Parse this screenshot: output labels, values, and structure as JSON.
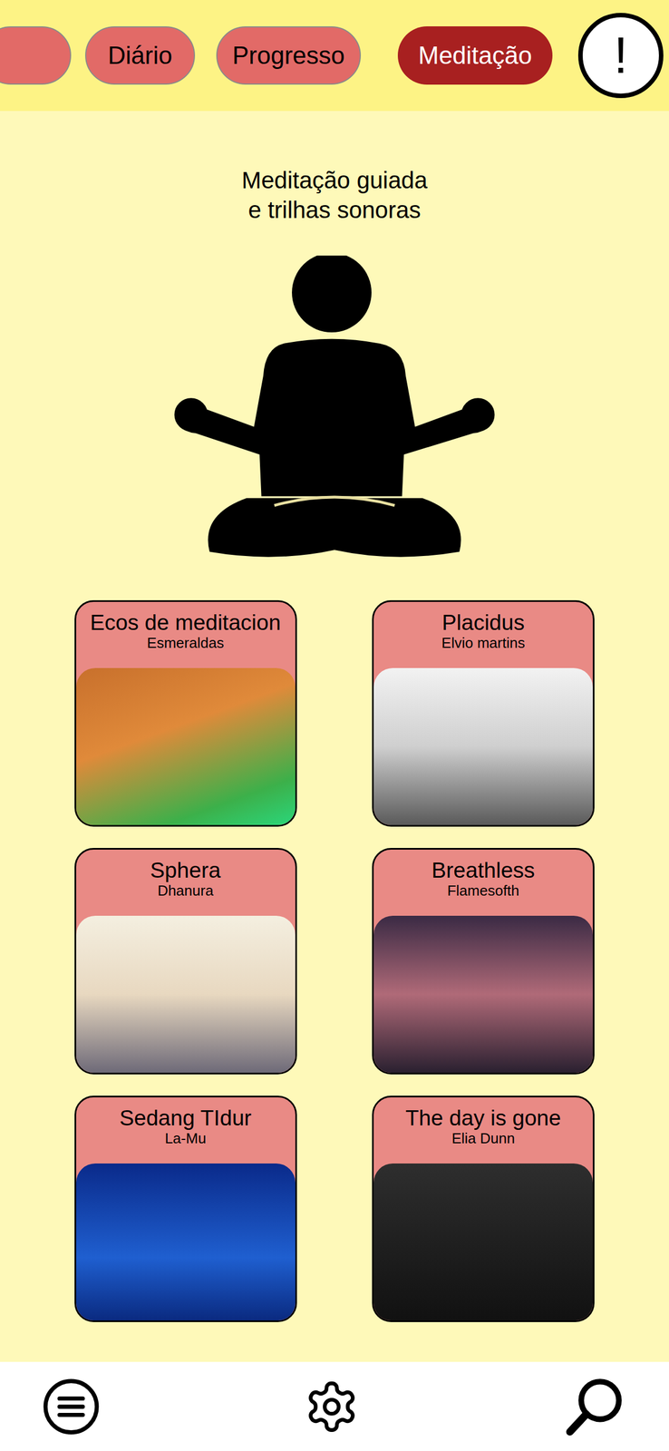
{
  "tabs": [
    {
      "label": "",
      "selected": false
    },
    {
      "label": "Diário",
      "selected": false
    },
    {
      "label": "Progresso",
      "selected": false
    },
    {
      "label": "Meditação",
      "selected": true
    }
  ],
  "alert_button": "!",
  "title": [
    "Meditação guiada",
    "e trilhas sonoras"
  ],
  "tracks": [
    {
      "title": "Ecos de meditacion",
      "artist": "Esmeraldas"
    },
    {
      "title": "Placidus",
      "artist": "Elvio martins"
    },
    {
      "title": "Sphera",
      "artist": "Dhanura"
    },
    {
      "title": "Breathless",
      "artist": "Flamesofth"
    },
    {
      "title": "Sedang TIdur",
      "artist": "La-Mu"
    },
    {
      "title": "The day is gone",
      "artist": "Elia Dunn"
    }
  ]
}
